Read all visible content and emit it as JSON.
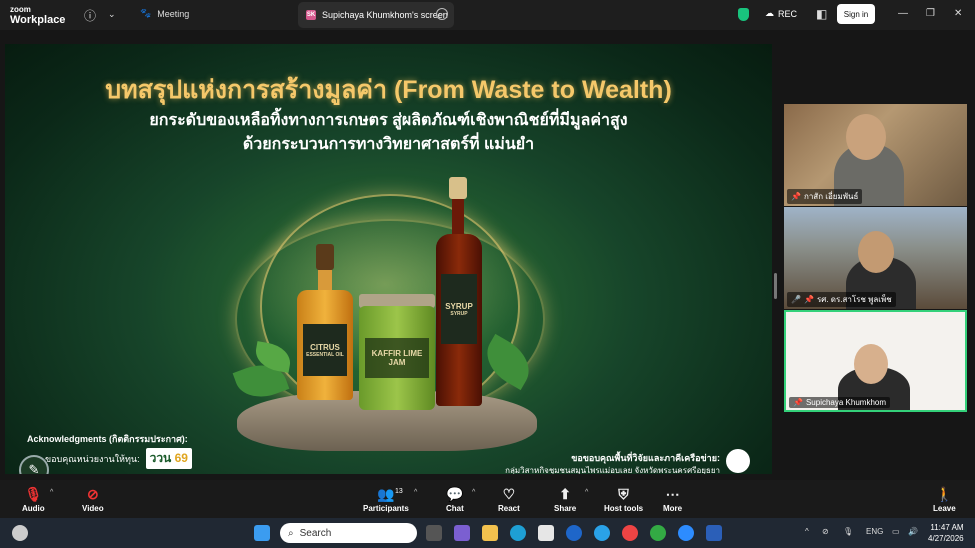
{
  "app": {
    "logo_line1": "zoom",
    "logo_line2": "Workplace",
    "meeting_label": "Meeting",
    "share_tab_initials": "SK",
    "share_tab_title": "Supichaya Khumkhom's screen",
    "rec_label": "REC",
    "signin_label": "Sign in"
  },
  "slide": {
    "title": "บทสรุปแห่งการสร้างมูลค่า (From Waste to Wealth)",
    "subtitle1": "ยกระดับของเหลือทิ้งทางการเกษตร สู่ผลิตภัณฑ์เชิงพาณิชย์ที่มีมูลค่าสูง",
    "subtitle2": "ด้วยกระบวนการทางวิทยาศาสตร์ที่ แม่นยำ",
    "product1_line1": "CITRUS",
    "product1_line2": "ESSENTIAL OIL",
    "product2_line1": "KAFFIR LIME",
    "product2_line2": "JAM",
    "product3_line1": "SYRUP",
    "product3_line2": "SYRUP",
    "ack_title": "Acknowledgments (กิตติกรรมประกาศ):",
    "ack_text": "ขอบคุณหน่วยงานให้ทุน:",
    "ack_badge_a": "ววน",
    "ack_badge_b": "69",
    "thanks_title": "ขอขอบคุณพื้นที่วิจัยและภาคีเครือข่าย:",
    "thanks_text": "กลุ่มวิสาหกิจชุมชนสมุนไพรแม่อบเลย จังหวัดพระนครศรีอยุธยา"
  },
  "participants": [
    {
      "name": "กาสัก เอี่ยมพันธ์"
    },
    {
      "name": "รศ. ดร.สาโรช พูลเพ็ช"
    },
    {
      "name": "Supichaya Khumkhom"
    }
  ],
  "toolbar": {
    "audio": "Audio",
    "video": "Video",
    "participants": "Participants",
    "participants_count": "13",
    "chat": "Chat",
    "react": "React",
    "share": "Share",
    "host_tools": "Host tools",
    "more": "More",
    "leave": "Leave"
  },
  "taskbar": {
    "search_placeholder": "Search",
    "lang": "ENG",
    "time": "11:47 AM",
    "date": "4/27/2026"
  }
}
